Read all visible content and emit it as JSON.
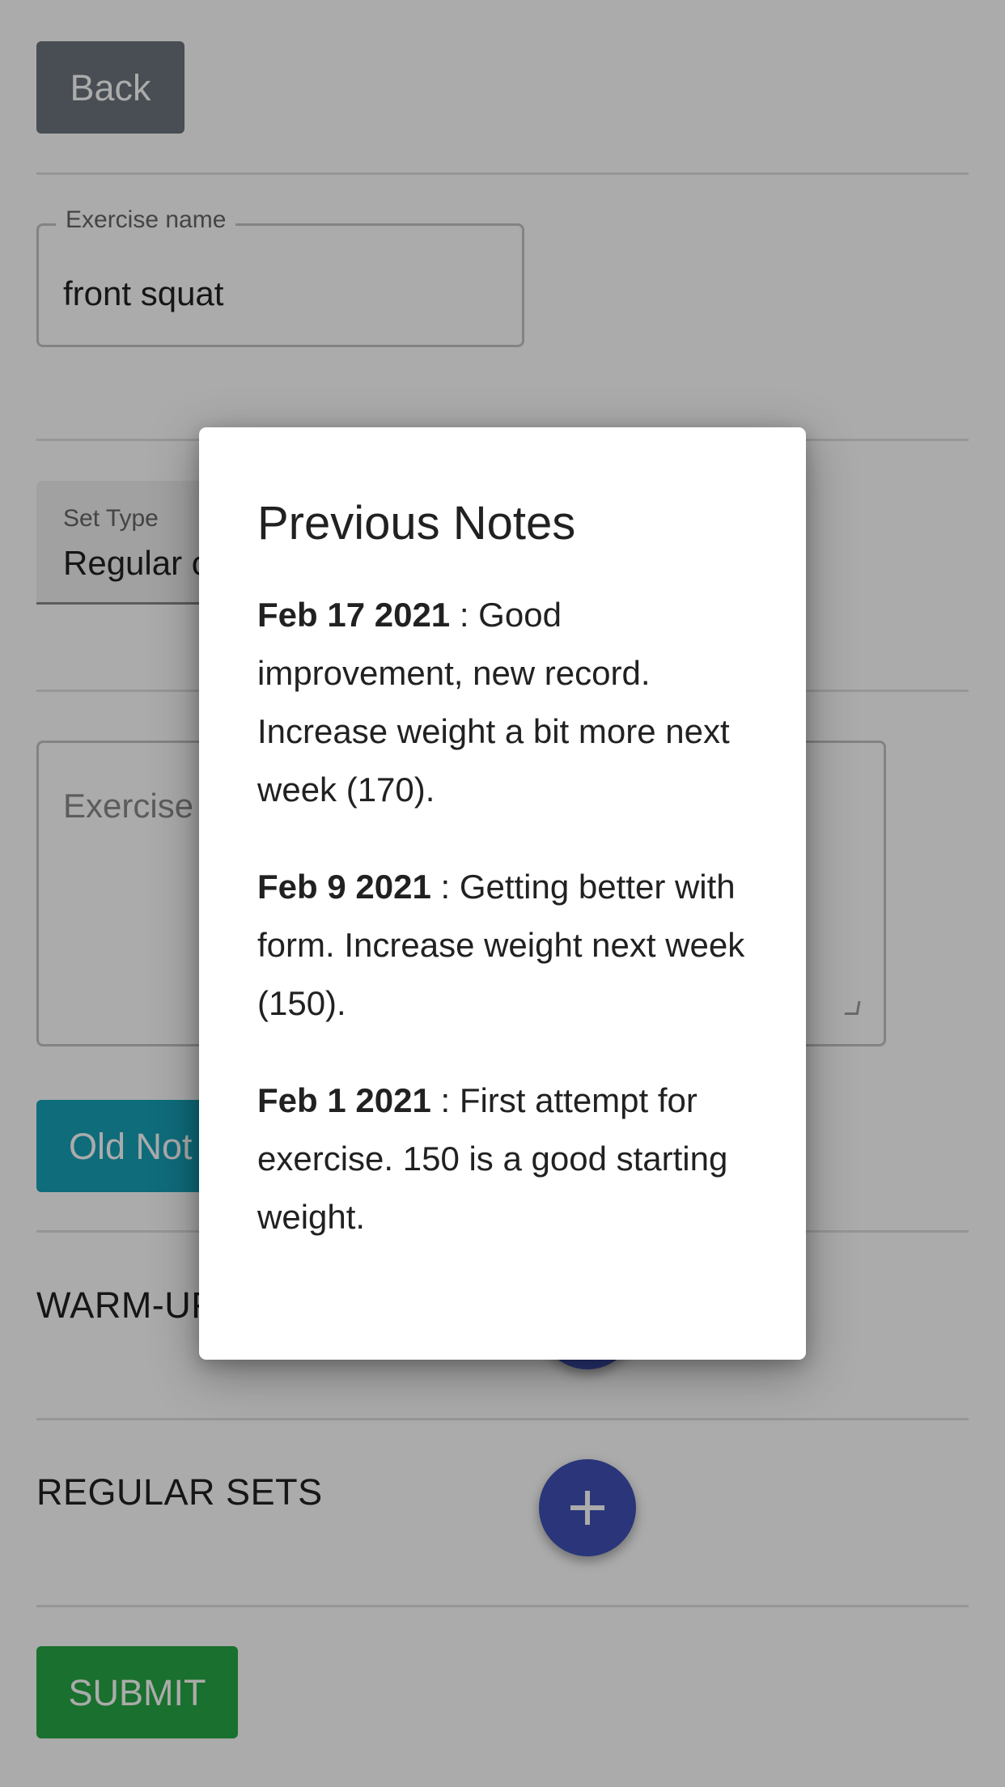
{
  "form": {
    "back_label": "Back",
    "exercise_name": {
      "label": "Exercise name",
      "value": "front squat"
    },
    "set_type": {
      "label": "Set Type",
      "value": "Regular c"
    },
    "exercise_notes": {
      "placeholder": "Exercise"
    },
    "old_notes_label": "Old Not",
    "sections": {
      "warmup_label": "WARM-UF",
      "regular_label": "REGULAR SETS"
    },
    "submit_label": "SUBMIT"
  },
  "modal": {
    "title": "Previous Notes",
    "notes": [
      {
        "date": "Feb 17 2021",
        "text": " : Good improvement, new record. Increase weight a bit more next week (170)."
      },
      {
        "date": "Feb 9 2021",
        "text": " : Getting better with form. Increase weight next week (150)."
      },
      {
        "date": "Feb 1 2021",
        "text": " : First attempt for exercise. 150 is a good starting weight."
      }
    ]
  },
  "icons": {
    "add": "plus-icon",
    "dropdown": "chevron-down-icon"
  },
  "colors": {
    "back_button": "#6c757d",
    "old_notes_button": "#17a2b8",
    "fab": "#3f51b5",
    "submit_button": "#28a745"
  }
}
